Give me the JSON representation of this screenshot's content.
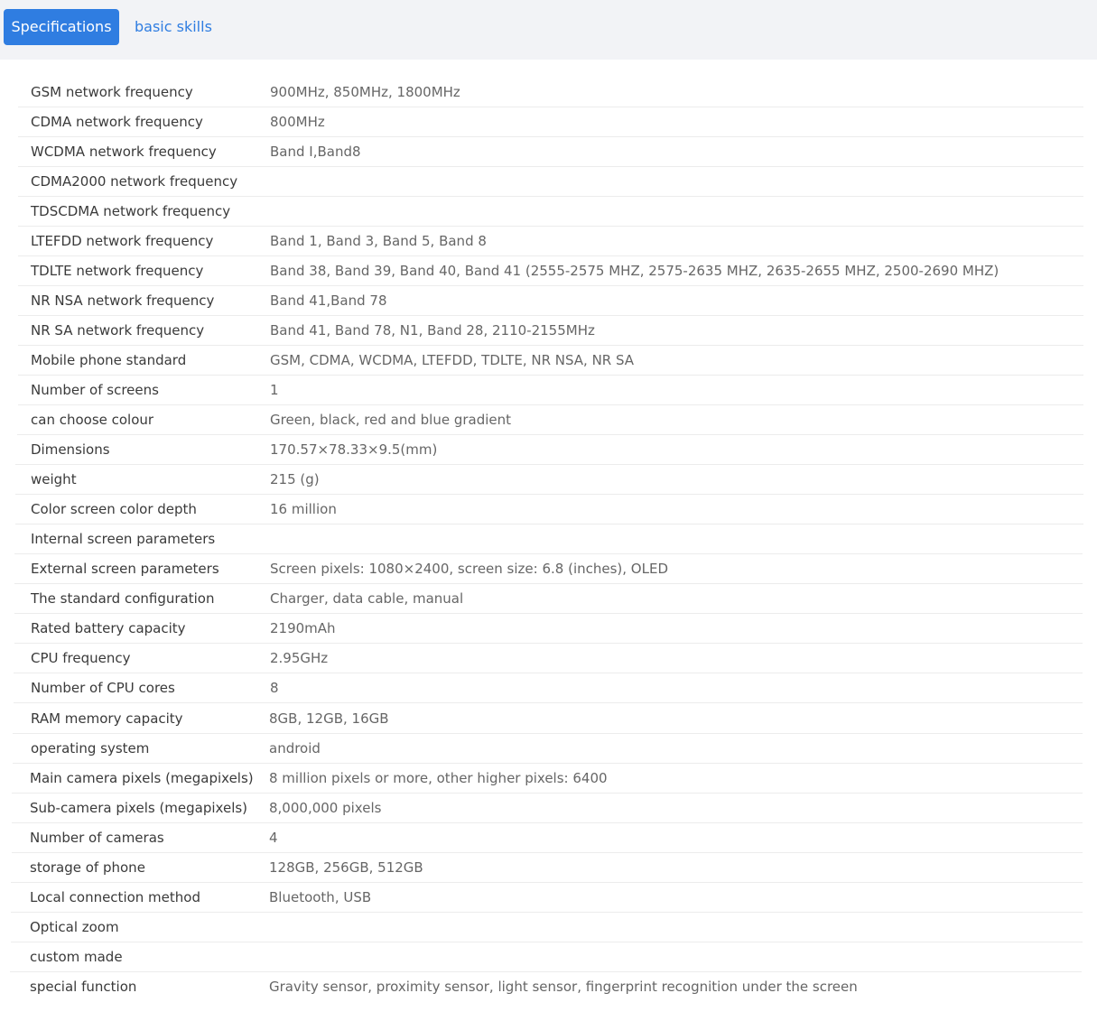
{
  "tabs": {
    "specifications": "Specifications",
    "basic_skills": "basic skills"
  },
  "specs": [
    {
      "label": "GSM network frequency",
      "value": "900MHz, 850MHz, 1800MHz"
    },
    {
      "label": "CDMA network frequency",
      "value": "800MHz"
    },
    {
      "label": "WCDMA network frequency",
      "value": "Band I,Band8"
    },
    {
      "label": "CDMA2000 network frequency",
      "value": ""
    },
    {
      "label": "TDSCDMA network frequency",
      "value": ""
    },
    {
      "label": "LTEFDD network frequency",
      "value": "Band 1, Band 3, Band 5, Band 8"
    },
    {
      "label": "TDLTE network frequency",
      "value": "Band 38, Band 39, Band 40, Band 41 (2555-2575 MHZ, 2575-2635 MHZ, 2635-2655 MHZ, 2500-2690 MHZ)"
    },
    {
      "label": "NR NSA network frequency",
      "value": "Band 41,Band 78"
    },
    {
      "label": "NR SA network frequency",
      "value": "Band 41, Band 78, N1, Band 28, 2110-2155MHz"
    },
    {
      "label": "Mobile phone standard",
      "value": "GSM, CDMA, WCDMA, LTEFDD, TDLTE, NR NSA, NR SA"
    },
    {
      "label": "Number of screens",
      "value": "1"
    },
    {
      "label": "can choose colour",
      "value": "Green, black, red and blue gradient"
    },
    {
      "label": "Dimensions",
      "value": "170.57×78.33×9.5(mm)"
    },
    {
      "label": "weight",
      "value": "215 (g)"
    },
    {
      "label": "Color screen color depth",
      "value": "16 million"
    },
    {
      "label": "Internal screen parameters",
      "value": ""
    },
    {
      "label": "External screen parameters",
      "value": "Screen pixels: 1080×2400, screen size: 6.8 (inches), OLED"
    },
    {
      "label": "The standard configuration",
      "value": "Charger, data cable, manual"
    },
    {
      "label": "Rated battery capacity",
      "value": "2190mAh"
    },
    {
      "label": "CPU frequency",
      "value": "2.95GHz"
    },
    {
      "label": "Number of CPU cores",
      "value": "8"
    },
    {
      "label": "RAM memory capacity",
      "value": "8GB, 12GB, 16GB"
    },
    {
      "label": "operating system",
      "value": "android"
    },
    {
      "label": "Main camera pixels (megapixels)",
      "value": "8 million pixels or more, other higher pixels: 6400"
    },
    {
      "label": "Sub-camera pixels (megapixels)",
      "value": "8,000,000 pixels"
    },
    {
      "label": "Number of cameras",
      "value": "4"
    },
    {
      "label": "storage of phone",
      "value": "128GB, 256GB, 512GB"
    },
    {
      "label": "Local connection method",
      "value": "Bluetooth, USB"
    },
    {
      "label": "Optical zoom",
      "value": ""
    },
    {
      "label": "custom made",
      "value": ""
    },
    {
      "label": "special function",
      "value": "Gravity sensor, proximity sensor, light sensor, fingerprint recognition under the screen"
    }
  ]
}
